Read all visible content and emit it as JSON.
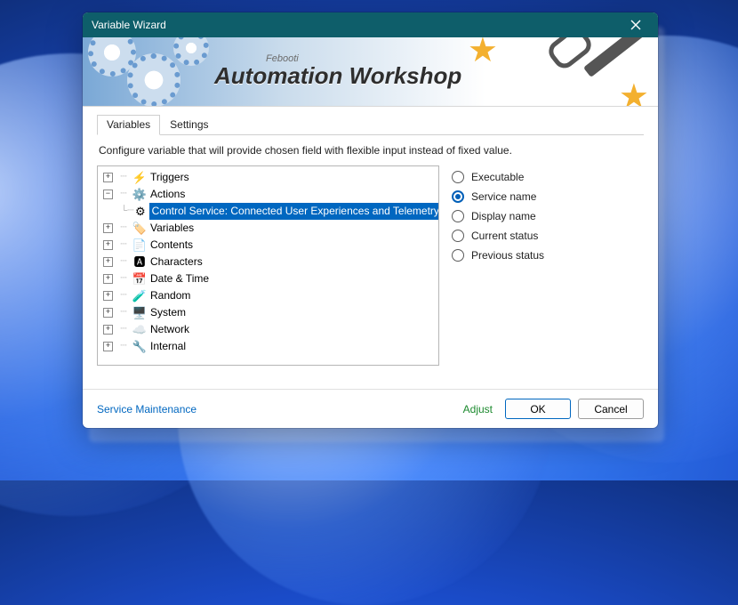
{
  "window": {
    "title": "Variable Wizard"
  },
  "banner": {
    "brand": "Febooti",
    "product": "Automation Workshop"
  },
  "tabs": [
    {
      "key": "variables",
      "label": "Variables",
      "active": true
    },
    {
      "key": "settings",
      "label": "Settings",
      "active": false
    }
  ],
  "instruction": "Configure variable that will provide chosen field with flexible input instead of fixed value.",
  "tree": {
    "items": [
      {
        "key": "triggers",
        "label": "Triggers",
        "expandable": true,
        "expanded": false,
        "icon": "⚡"
      },
      {
        "key": "actions",
        "label": "Actions",
        "expandable": true,
        "expanded": true,
        "icon": "⚙️",
        "children": [
          {
            "key": "control-service",
            "label": "Control Service: Connected User Experiences and Telemetry",
            "icon": "⚙",
            "selected": true
          }
        ]
      },
      {
        "key": "variables",
        "label": "Variables",
        "expandable": true,
        "expanded": false,
        "icon": "🏷️"
      },
      {
        "key": "contents",
        "label": "Contents",
        "expandable": true,
        "expanded": false,
        "icon": "📄"
      },
      {
        "key": "characters",
        "label": "Characters",
        "expandable": true,
        "expanded": false,
        "icon": "🅰"
      },
      {
        "key": "datetime",
        "label": "Date & Time",
        "expandable": true,
        "expanded": false,
        "icon": "📅"
      },
      {
        "key": "random",
        "label": "Random",
        "expandable": true,
        "expanded": false,
        "icon": "🧪"
      },
      {
        "key": "system",
        "label": "System",
        "expandable": true,
        "expanded": false,
        "icon": "🖥️"
      },
      {
        "key": "network",
        "label": "Network",
        "expandable": true,
        "expanded": false,
        "icon": "☁️"
      },
      {
        "key": "internal",
        "label": "Internal",
        "expandable": true,
        "expanded": false,
        "icon": "🔧"
      }
    ]
  },
  "radios": [
    {
      "key": "executable",
      "label": "Executable",
      "checked": false
    },
    {
      "key": "service-name",
      "label": "Service name",
      "checked": true
    },
    {
      "key": "display-name",
      "label": "Display name",
      "checked": false
    },
    {
      "key": "current-status",
      "label": "Current status",
      "checked": false
    },
    {
      "key": "previous-status",
      "label": "Previous status",
      "checked": false
    }
  ],
  "footer": {
    "link": "Service Maintenance",
    "adjust": "Adjust",
    "ok": "OK",
    "cancel": "Cancel"
  }
}
